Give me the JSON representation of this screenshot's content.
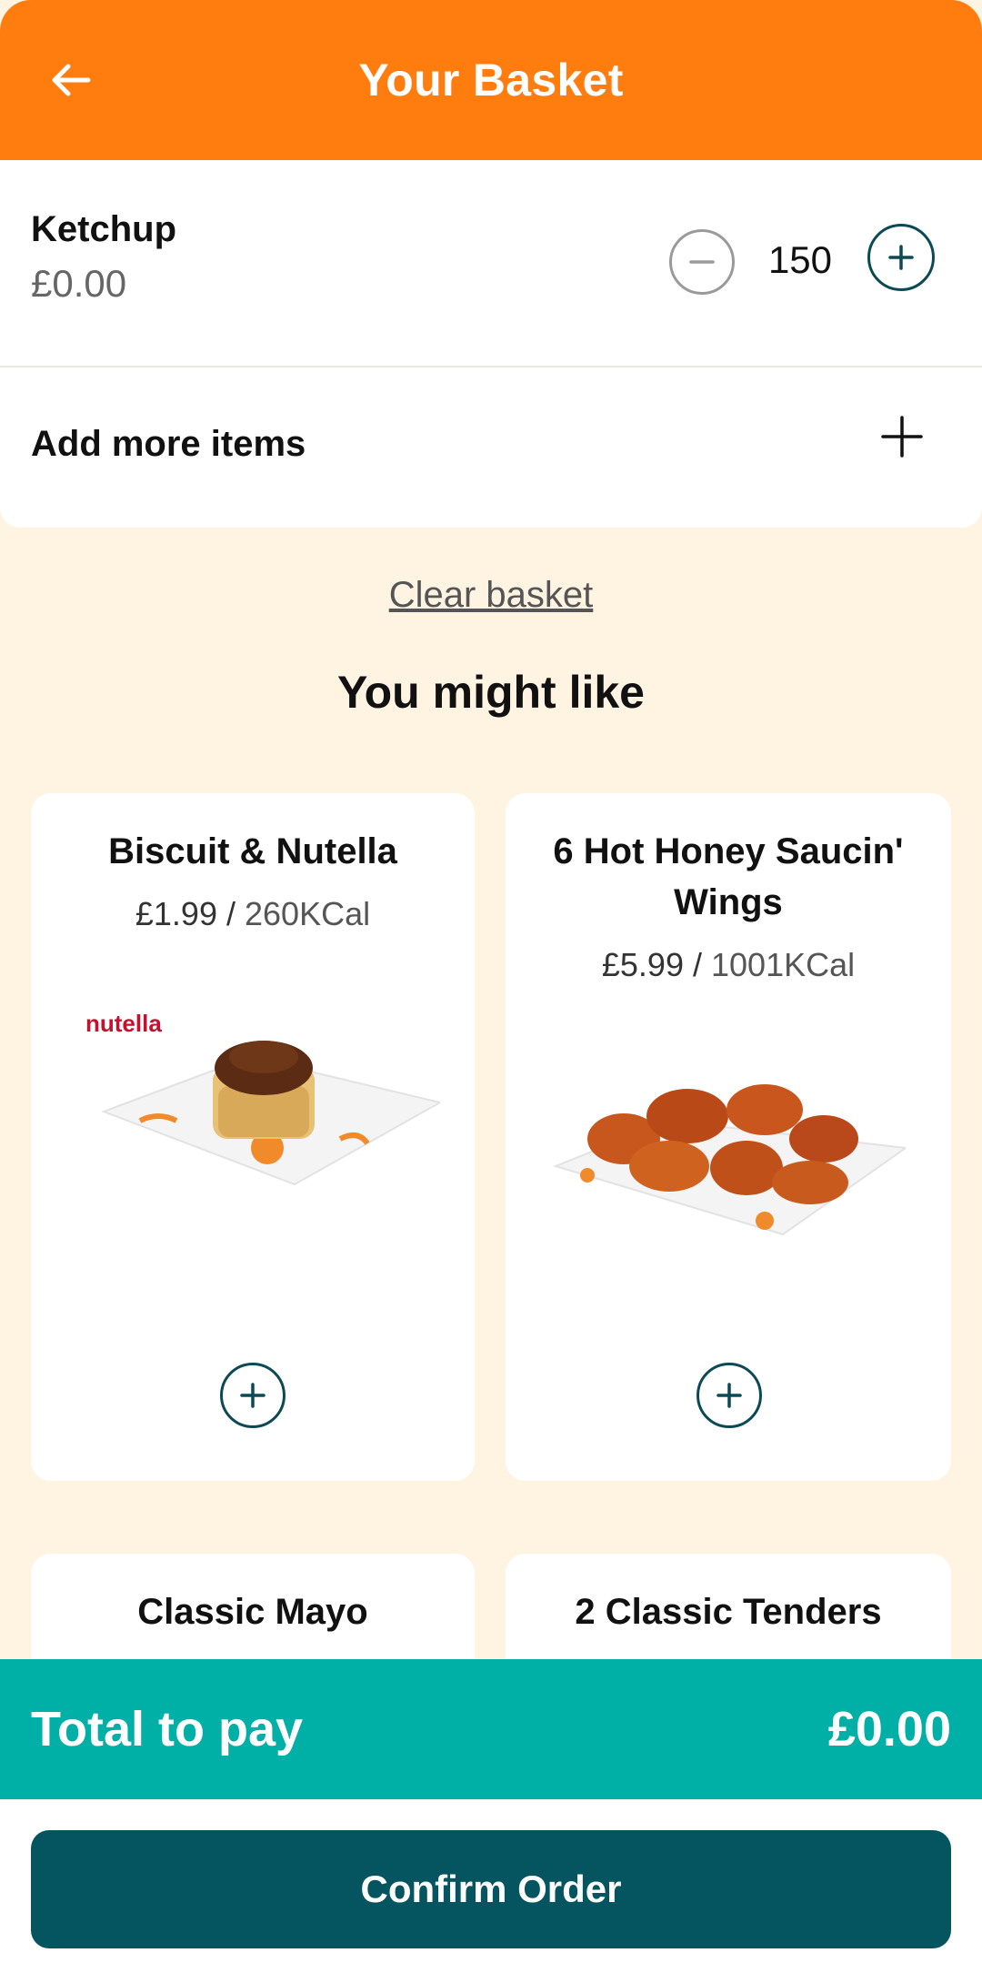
{
  "header": {
    "title": "Your Basket",
    "back_icon": "arrow-left-icon"
  },
  "basket_item": {
    "name": "Ketchup",
    "price": "£0.00",
    "quantity": "150"
  },
  "add_more": {
    "label": "Add more items"
  },
  "clear_basket": "Clear basket",
  "suggestions": {
    "title": "You might like",
    "items": [
      {
        "name": "Biscuit & Nutella",
        "price": "£1.99",
        "kcal": "260KCal",
        "logo_text": "nutella"
      },
      {
        "name": "6 Hot Honey Saucin' Wings",
        "price": "£5.99",
        "kcal": "1001KCal"
      },
      {
        "name": "Classic Mayo"
      },
      {
        "name": "2 Classic Tenders"
      }
    ]
  },
  "total": {
    "label": "Total to pay",
    "value": "£0.00"
  },
  "confirm_label": "Confirm Order",
  "colors": {
    "header": "#FF7C0F",
    "background": "#FFF3E2",
    "total_bar": "#00AFA6",
    "primary": "#04555F"
  }
}
